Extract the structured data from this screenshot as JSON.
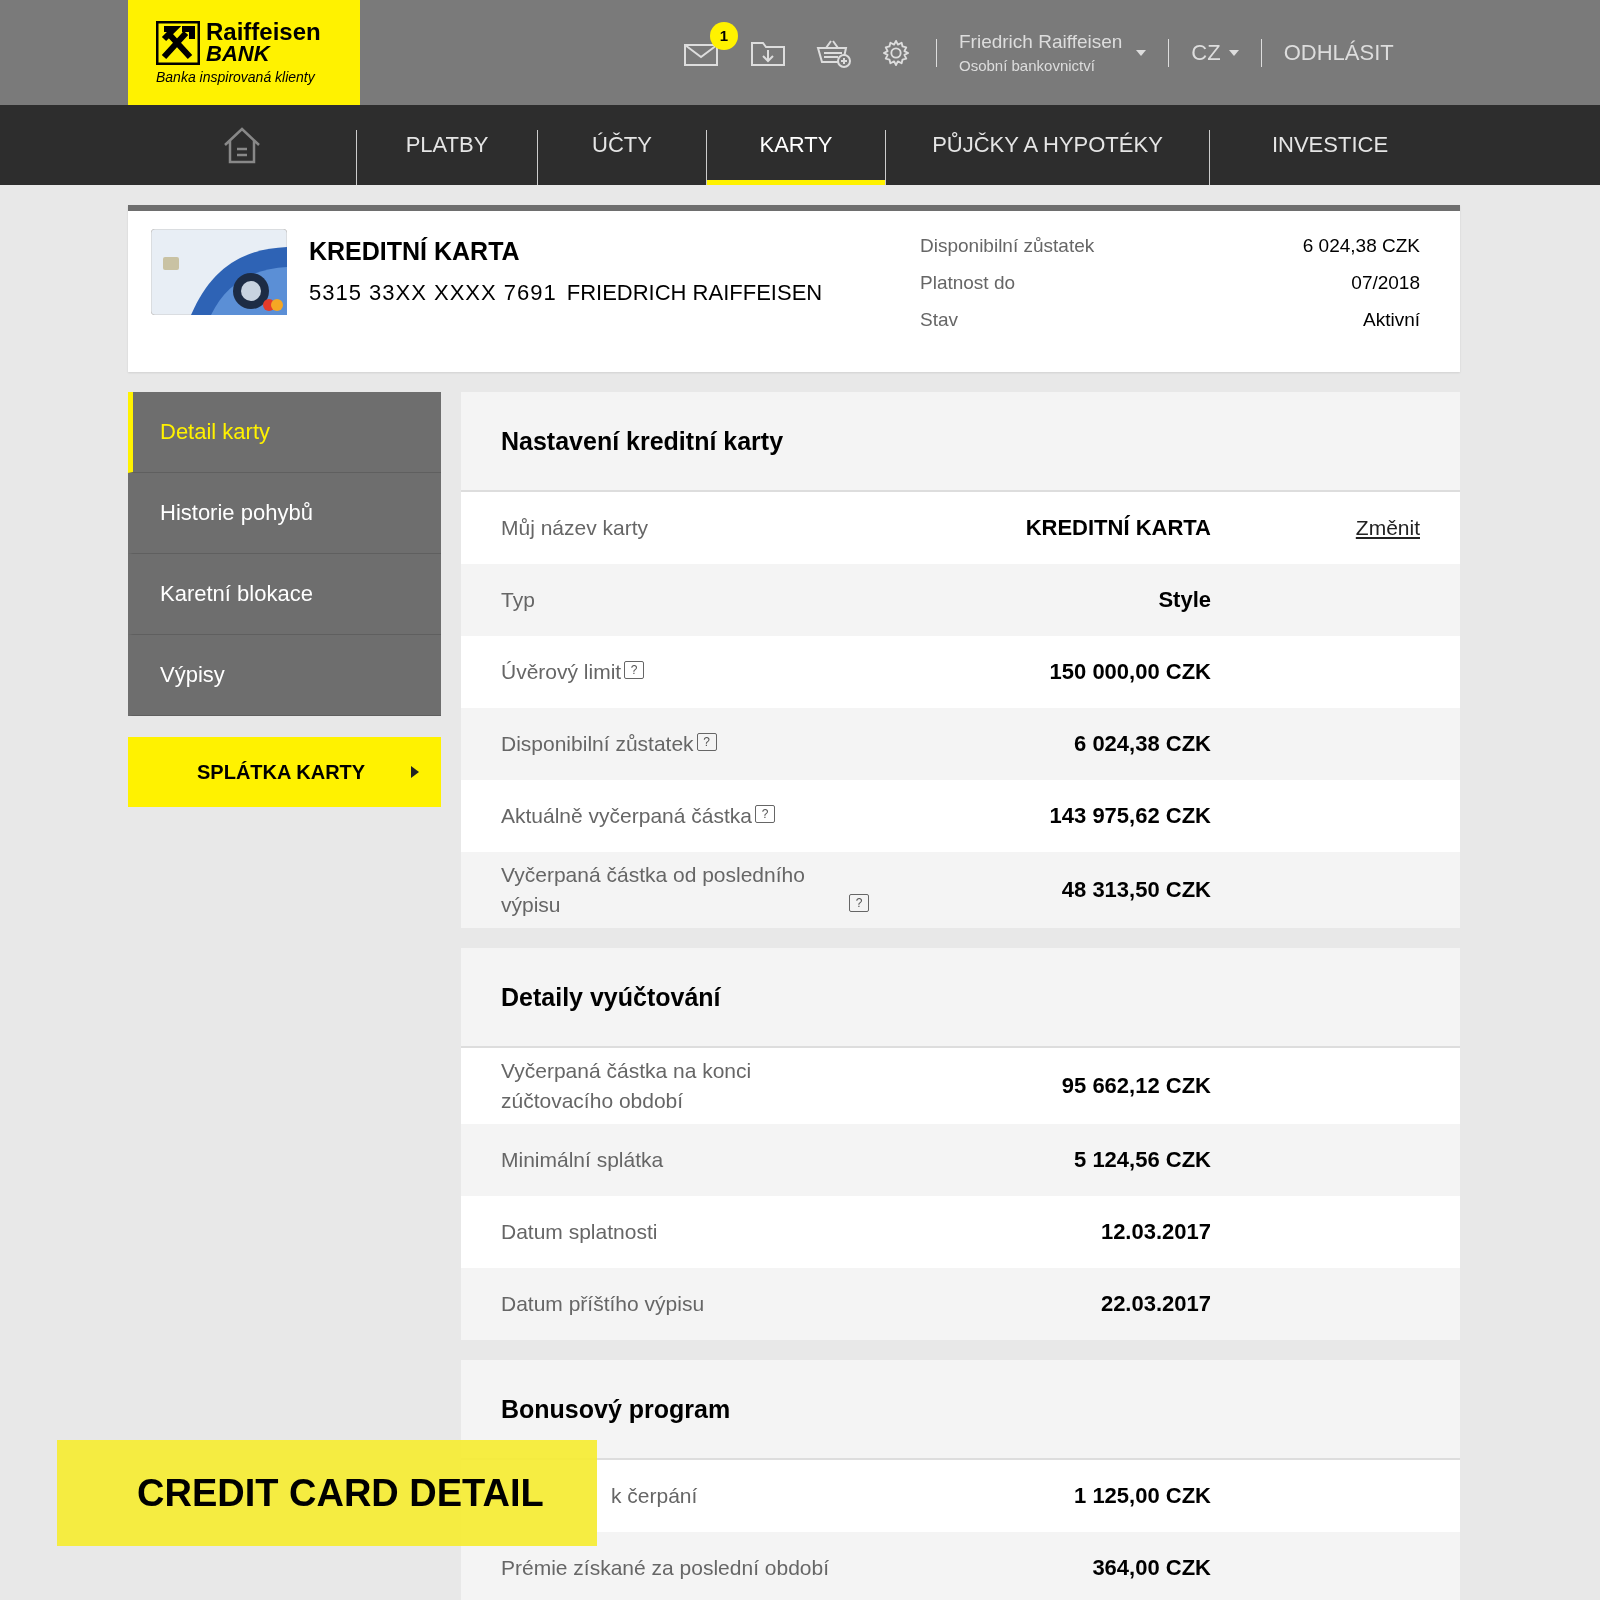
{
  "logo": {
    "name": "Raiffeisen",
    "sub": "BANK",
    "slogan": "Banka inspirovaná klienty"
  },
  "header": {
    "mail_badge": "1",
    "user_name": "Friedrich Raiffeisen",
    "user_role": "Osobní bankovnictví",
    "language": "CZ",
    "logout": "ODHLÁSIT"
  },
  "nav": [
    {
      "kind": "home",
      "selected": false
    },
    {
      "label": "PLATBY",
      "selected": false
    },
    {
      "label": "ÚČTY",
      "selected": false
    },
    {
      "label": "KARTY",
      "selected": true
    },
    {
      "label": "PŮJČKY A HYPOTÉKY",
      "selected": false
    },
    {
      "label": "INVESTICE",
      "selected": false
    }
  ],
  "card": {
    "title": "KREDITNÍ KARTA",
    "number": "5315 33XX XXXX 7691",
    "holder": "FRIEDRICH RAIFFEISEN",
    "details": [
      {
        "label": "Disponibilní zůstatek",
        "value": "6 024,38 CZK"
      },
      {
        "label": "Platnost do",
        "value": "07/2018"
      },
      {
        "label": "Stav",
        "value": "Aktivní"
      }
    ]
  },
  "sidebar": {
    "items": [
      {
        "label": "Detail karty",
        "selected": true
      },
      {
        "label": "Historie pohybů",
        "selected": false
      },
      {
        "label": "Karetní blokace",
        "selected": false
      },
      {
        "label": "Výpisy",
        "selected": false
      }
    ],
    "button": "SPLÁTKA KARTY"
  },
  "sections": [
    {
      "title": "Nastavení kreditní karty",
      "rows": [
        {
          "label": "Můj název karty",
          "value": "KREDITNÍ KARTA",
          "link": "Změnit"
        },
        {
          "label": "Typ",
          "value": "Style"
        },
        {
          "label": "Úvěrový limit",
          "value": "150 000,00 CZK",
          "help": "?"
        },
        {
          "label": "Disponibilní zůstatek",
          "value": "6 024,38 CZK",
          "help": "?"
        },
        {
          "label": "Aktuálně vyčerpaná částka",
          "value": "143 975,62 CZK",
          "help": "?"
        },
        {
          "label": "Vyčerpaná částka od posledního výpisu",
          "value": "48 313,50 CZK",
          "help": "?"
        }
      ]
    },
    {
      "title": "Detaily vyúčtování",
      "rows": [
        {
          "label": "Vyčerpaná částka na konci zúčtovacího období",
          "value": "95 662,12 CZK"
        },
        {
          "label": "Minimální splátka",
          "value": "5 124,56 CZK"
        },
        {
          "label": "Datum splatnosti",
          "value": "12.03.2017"
        },
        {
          "label": "Datum příštího výpisu",
          "value": "22.03.2017"
        }
      ]
    },
    {
      "title": "Bonusový program",
      "rows": [
        {
          "label": "k čerpání",
          "value": "1 125,00 CZK",
          "covered": true
        },
        {
          "label": "Prémie získané za poslední období",
          "value": "364,00 CZK",
          "covered": false
        }
      ]
    }
  ],
  "banner": "CREDIT CARD DETAIL"
}
